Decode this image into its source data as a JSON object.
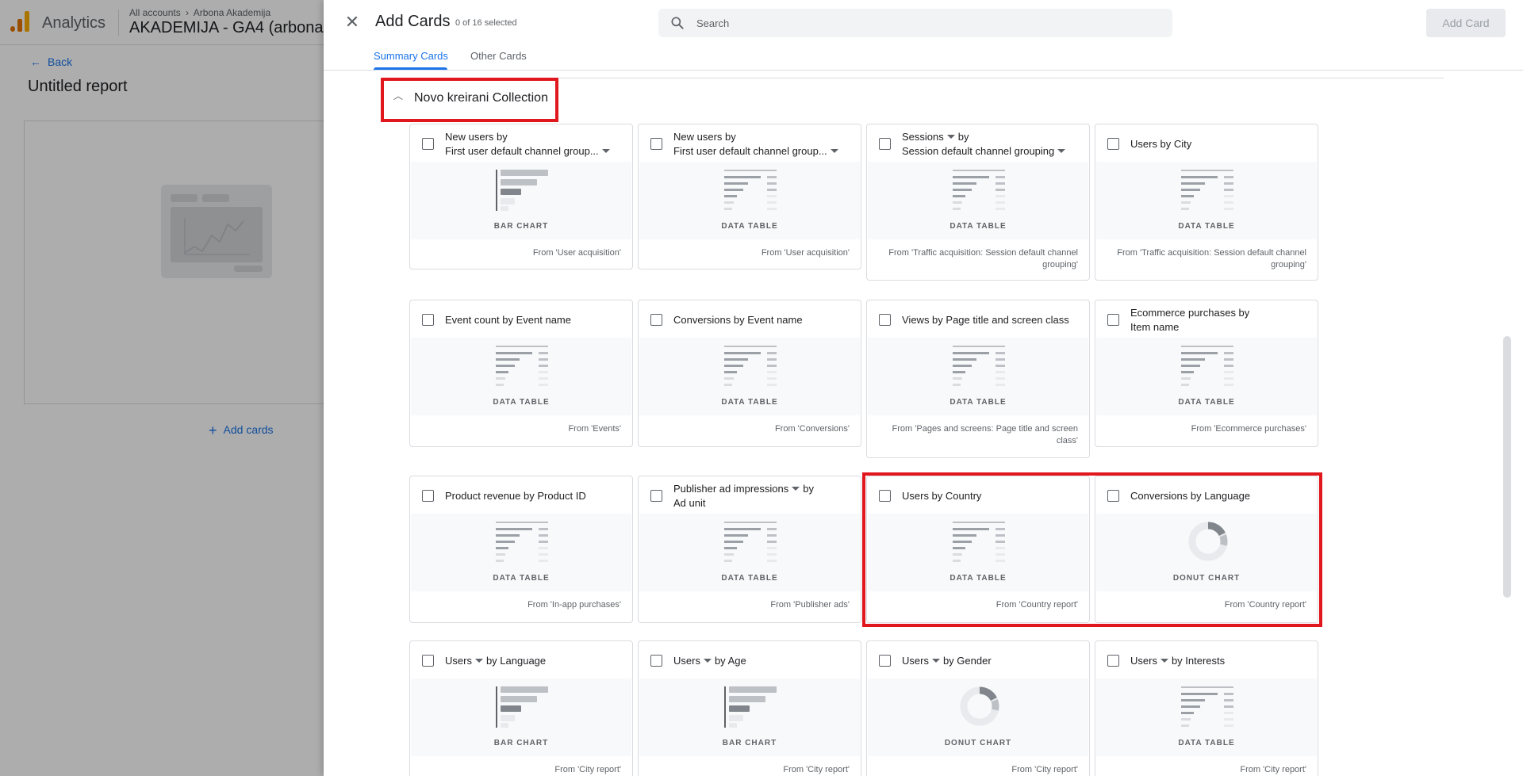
{
  "app": {
    "name": "Analytics",
    "breadcrumb_root": "All accounts",
    "breadcrumb_account": "Arbona Akademija",
    "property": "AKADEMIJA - GA4 (arbona"
  },
  "report": {
    "back_label": "Back",
    "title": "Untitled report",
    "add_cards_label": "Add cards"
  },
  "drawer": {
    "title": "Add Cards",
    "selected_count": "0 of 16 selected",
    "search_placeholder": "Search",
    "add_button": "Add Card",
    "tabs": [
      "Summary Cards",
      "Other Cards"
    ],
    "active_tab": 0,
    "collection_title": "Novo kreirani Collection"
  },
  "cards": [
    {
      "title": "New users by",
      "title2": "First user default channel group...",
      "dd1": false,
      "dd2": true,
      "preview": "BAR CHART",
      "from": "From 'User acquisition'"
    },
    {
      "title": "New users by",
      "title2": "First user default channel group...",
      "dd1": false,
      "dd2": true,
      "preview": "DATA TABLE",
      "from": "From 'User acquisition'"
    },
    {
      "title": "Sessions",
      "title_after": "by",
      "title2": "Session default channel grouping",
      "dd1": true,
      "dd2": true,
      "preview": "DATA TABLE",
      "from": "From 'Traffic acquisition: Session default channel grouping'"
    },
    {
      "title": "Users by City",
      "preview": "DATA TABLE",
      "from": "From 'Traffic acquisition: Session default channel grouping'"
    },
    {
      "title": "Event count by Event name",
      "preview": "DATA TABLE",
      "from": "From 'Events'"
    },
    {
      "title": "Conversions by Event name",
      "preview": "DATA TABLE",
      "from": "From 'Conversions'"
    },
    {
      "title": "Views by Page title and screen class",
      "preview": "DATA TABLE",
      "from": "From 'Pages and screens: Page title and screen class'"
    },
    {
      "title": "Ecommerce purchases by",
      "title2": "Item name",
      "preview": "DATA TABLE",
      "from": "From 'Ecommerce purchases'"
    },
    {
      "title": "Product revenue by Product ID",
      "preview": "DATA TABLE",
      "from": "From 'In-app purchases'"
    },
    {
      "title": "Publisher ad impressions",
      "title_after": "by",
      "title2": "Ad unit",
      "dd1": true,
      "preview": "DATA TABLE",
      "from": "From 'Publisher ads'"
    },
    {
      "title": "Users by Country",
      "preview": "DATA TABLE",
      "from": "From 'Country report'"
    },
    {
      "title": "Conversions by Language",
      "preview": "DONUT CHART",
      "from": "From 'Country report'"
    },
    {
      "title": "Users",
      "title_after": "by Language",
      "dd1": true,
      "preview": "BAR CHART",
      "from": "From 'City report'"
    },
    {
      "title": "Users",
      "title_after": "by Age",
      "dd1": true,
      "preview": "BAR CHART",
      "from": "From 'City report'"
    },
    {
      "title": "Users",
      "title_after": "by Gender",
      "dd1": true,
      "preview": "DONUT CHART",
      "from": "From 'City report'"
    },
    {
      "title": "Users",
      "title_after": "by Interests",
      "dd1": true,
      "preview": "DATA TABLE",
      "from": "From 'City report'"
    }
  ],
  "colors": {
    "accent": "#1a73e8",
    "highlight_box": "#e1171e"
  }
}
